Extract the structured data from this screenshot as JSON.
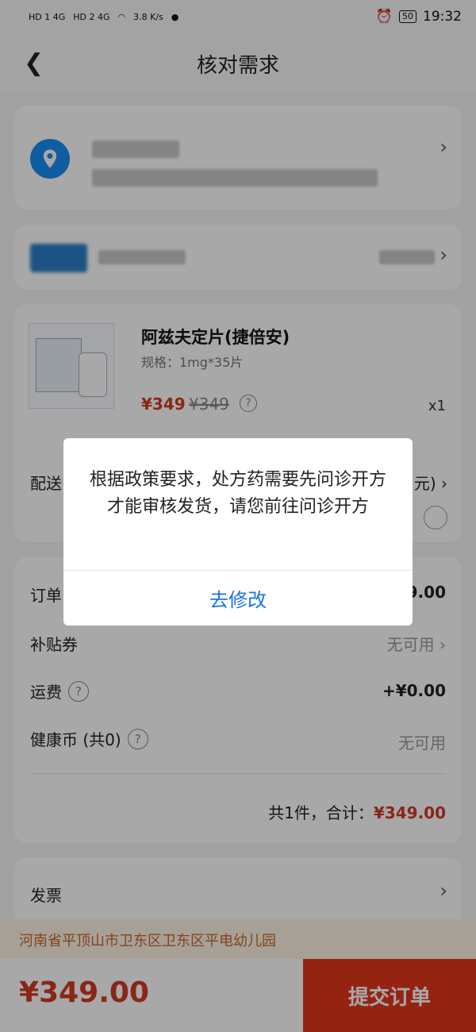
{
  "status_bar": {
    "network_a": "HD 1  4G",
    "network_b": "HD 2  4G",
    "speed": "3.8 K/s",
    "battery": "50",
    "time": "19:32"
  },
  "nav": {
    "back_icon": "chevron-left-icon",
    "title": "核对需求"
  },
  "product": {
    "name": "阿兹夫定片(捷倍安)",
    "spec": "规格：1mg*35片",
    "price": "¥349",
    "original_price": "¥349",
    "quantity": "x1"
  },
  "delivery": {
    "label": "配送",
    "tail": "元)"
  },
  "summary": {
    "order_label": "订单",
    "order_value": "9.00",
    "subsidy_label": "补贴券",
    "subsidy_value": "无可用",
    "shipping_label": "运费",
    "shipping_value": "+¥0.00",
    "health_coin_label": "健康币 (共0)",
    "health_coin_value": "无可用",
    "total_prefix": "共1件，合计：",
    "total_amount": "¥349.00"
  },
  "invoice": {
    "label": "发票"
  },
  "address_banner": "河南省平顶山市卫东区卫东区平电幼儿园",
  "bottom_bar": {
    "price": "¥349.00",
    "submit_label": "提交订单"
  },
  "dialog": {
    "message": "根据政策要求，处方药需要先问诊开方才能审核发货，请您前往问诊开方",
    "button_label": "去修改"
  },
  "colors": {
    "accent_red": "#d23a22",
    "submit_red": "#e2361c",
    "link_blue": "#1a73e8",
    "location_blue": "#1a8ef5"
  }
}
